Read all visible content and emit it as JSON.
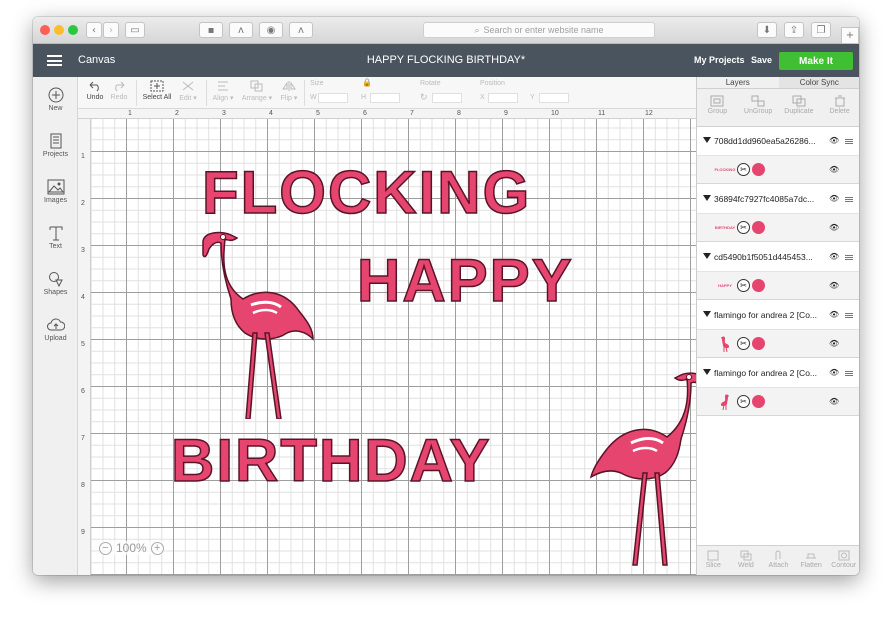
{
  "colors": {
    "brand_pink": "#e5456e",
    "make_it_green": "#40bf34",
    "header_bg": "#4a545e"
  },
  "browser": {
    "address_placeholder": "Search or enter website name"
  },
  "app": {
    "title": "Canvas",
    "document_title": "HAPPY FLOCKING BIRTHDAY*",
    "my_projects": "My Projects",
    "save": "Save",
    "make_it": "Make It"
  },
  "sidebar": [
    {
      "label": "New",
      "icon": "plus-circle-icon"
    },
    {
      "label": "Projects",
      "icon": "book-icon"
    },
    {
      "label": "Images",
      "icon": "image-icon"
    },
    {
      "label": "Text",
      "icon": "text-T-icon"
    },
    {
      "label": "Shapes",
      "icon": "shapes-icon"
    },
    {
      "label": "Upload",
      "icon": "cloud-upload-icon"
    }
  ],
  "toolbar": {
    "undo": "Undo",
    "redo": "Redo",
    "select_all": "Select All",
    "edit": "Edit",
    "align": "Align",
    "arrange": "Arrange",
    "flip": "Flip",
    "size": "Size",
    "w": "W",
    "h": "H",
    "rotate": "Rotate",
    "position": "Position",
    "x": "X",
    "y": "Y"
  },
  "ruler": {
    "h": [
      "1",
      "2",
      "3",
      "4",
      "5",
      "6",
      "7",
      "8",
      "9",
      "10",
      "11",
      "12"
    ],
    "v": [
      "1",
      "2",
      "3",
      "4",
      "5",
      "6",
      "7",
      "8",
      "9"
    ]
  },
  "canvas": {
    "words": [
      "FLOCKING",
      "HAPPY",
      "BIRTHDAY"
    ],
    "zoom": "100%"
  },
  "panel": {
    "tabs": [
      "Layers",
      "Color Sync"
    ],
    "actions": [
      "Group",
      "UnGroup",
      "Duplicate",
      "Delete"
    ],
    "layers": [
      {
        "name": "708dd1dd960ea5a26286...",
        "thumb": "FLOCKING"
      },
      {
        "name": "36894fc7927fc4085a7dc...",
        "thumb": "BIRTHDAY"
      },
      {
        "name": "cd5490b1f5051d445453...",
        "thumb": "HAPPY"
      },
      {
        "name": "flamingo for andrea 2 [Co...",
        "thumb": ""
      },
      {
        "name": "flamingo for andrea 2 [Co...",
        "thumb": ""
      }
    ],
    "bottom_actions": [
      "Slice",
      "Weld",
      "Attach",
      "Flatten",
      "Contour"
    ]
  }
}
